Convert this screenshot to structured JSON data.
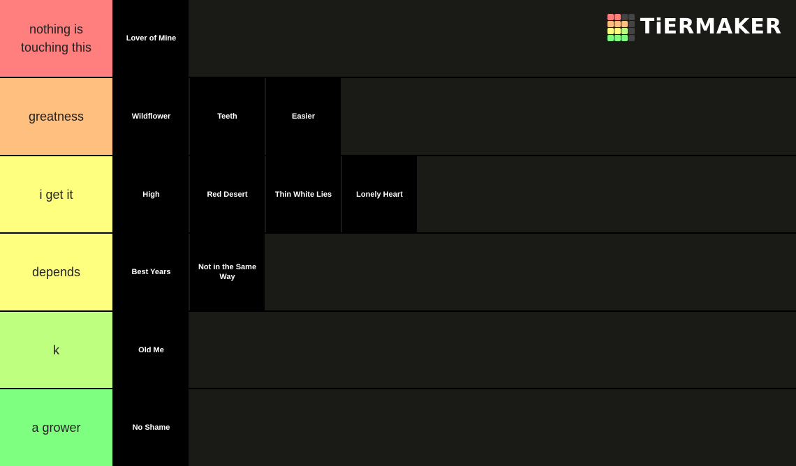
{
  "logo": {
    "text": "TiERMAKER",
    "grid_colors": [
      "#ff7f7f",
      "#ff7f7f",
      "#444444",
      "#444444",
      "#ffbf7f",
      "#ffbf7f",
      "#ffbf7f",
      "#444444",
      "#ffff7f",
      "#ffff7f",
      "#bfff7f",
      "#444444",
      "#7fff7f",
      "#7fff7f",
      "#7fff7f",
      "#444444"
    ]
  },
  "tiers": [
    {
      "label": "nothing is touching this",
      "color": "#ff7f7f",
      "items": [
        "Lover of Mine"
      ]
    },
    {
      "label": "greatness",
      "color": "#ffbf7f",
      "items": [
        "Wildflower",
        "Teeth",
        "Easier"
      ]
    },
    {
      "label": "i get it",
      "color": "#ffff7f",
      "items": [
        "High",
        "Red Desert",
        "Thin White Lies",
        "Lonely Heart"
      ]
    },
    {
      "label": "depends",
      "color": "#ffff7f",
      "items": [
        "Best Years",
        "Not in the Same Way"
      ]
    },
    {
      "label": "k",
      "color": "#bfff7f",
      "items": [
        "Old Me"
      ]
    },
    {
      "label": "a grower",
      "color": "#7fff7f",
      "items": [
        "No Shame"
      ]
    }
  ]
}
